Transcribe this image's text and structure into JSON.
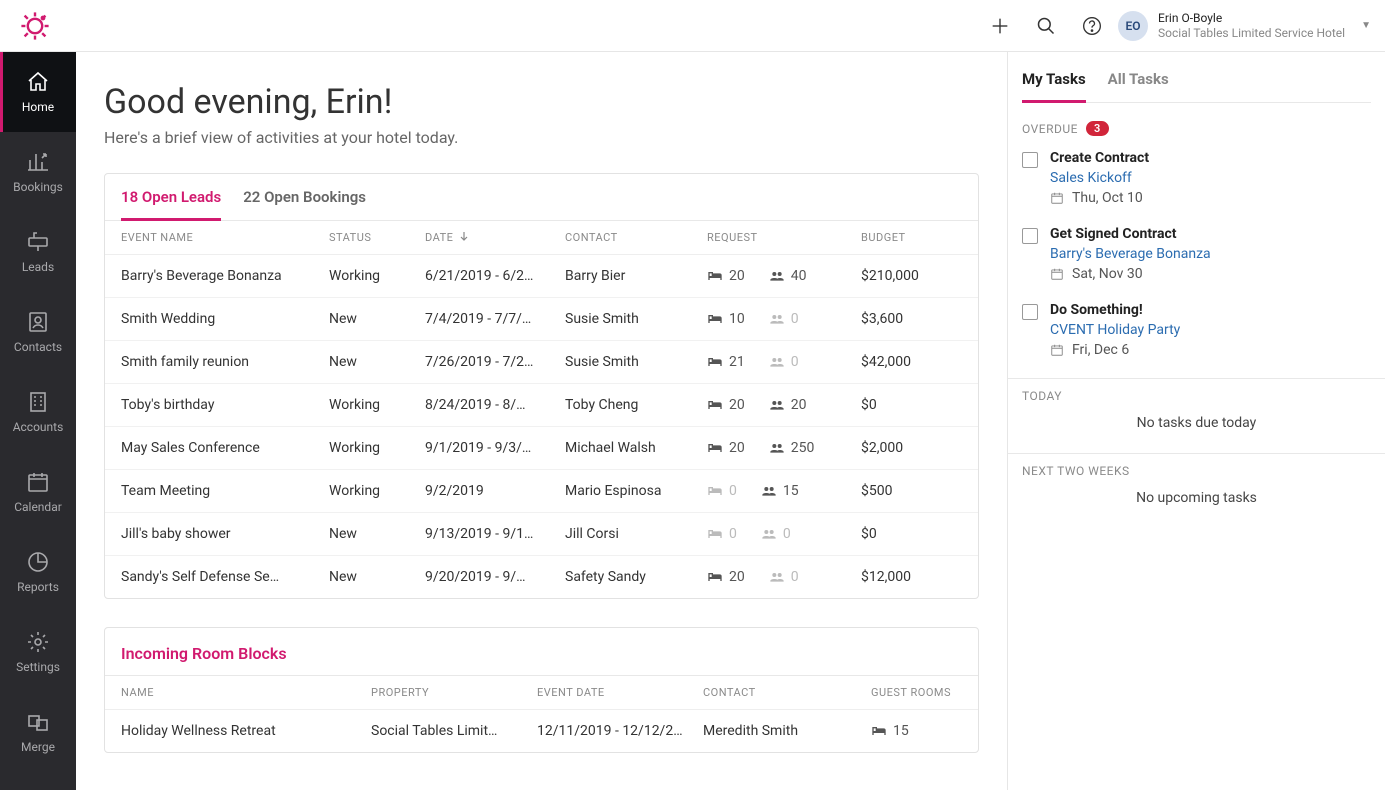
{
  "brand_color": "#d11a6f",
  "header": {
    "user_initials": "EO",
    "user_name": "Erin O-Boyle",
    "user_sub": "Social Tables Limited Service Hotel"
  },
  "sidebar": {
    "items": [
      {
        "label": "Home"
      },
      {
        "label": "Bookings"
      },
      {
        "label": "Leads"
      },
      {
        "label": "Contacts"
      },
      {
        "label": "Accounts"
      },
      {
        "label": "Calendar"
      },
      {
        "label": "Reports"
      },
      {
        "label": "Settings"
      },
      {
        "label": "Merge"
      }
    ]
  },
  "greeting": "Good evening, Erin!",
  "subgreeting": "Here's a brief view of activities at your hotel today.",
  "leads": {
    "tab_leads": "18 Open Leads",
    "tab_bookings": "22 Open Bookings",
    "headers": {
      "event": "EVENT NAME",
      "status": "STATUS",
      "date": "DATE",
      "contact": "CONTACT",
      "request": "REQUEST",
      "budget": "BUDGET"
    },
    "rows": [
      {
        "event": "Barry's Beverage Bonanza",
        "status": "Working",
        "date": "6/21/2019 - 6/2…",
        "contact": "Barry Bier",
        "rooms": "20",
        "people": "40",
        "budget": "$210,000"
      },
      {
        "event": "Smith Wedding",
        "status": "New",
        "date": "7/4/2019 - 7/7/…",
        "contact": "Susie Smith",
        "rooms": "10",
        "people": "0",
        "budget": "$3,600"
      },
      {
        "event": "Smith family reunion",
        "status": "New",
        "date": "7/26/2019 - 7/2…",
        "contact": "Susie Smith",
        "rooms": "21",
        "people": "0",
        "budget": "$42,000"
      },
      {
        "event": "Toby's birthday",
        "status": "Working",
        "date": "8/24/2019 - 8/…",
        "contact": "Toby Cheng",
        "rooms": "20",
        "people": "20",
        "budget": "$0"
      },
      {
        "event": "May Sales Conference",
        "status": "Working",
        "date": "9/1/2019 - 9/3/…",
        "contact": "Michael Walsh",
        "rooms": "20",
        "people": "250",
        "budget": "$2,000"
      },
      {
        "event": "Team Meeting",
        "status": "Working",
        "date": "9/2/2019",
        "contact": "Mario Espinosa",
        "rooms": "0",
        "people": "15",
        "budget": "$500"
      },
      {
        "event": "Jill's baby shower",
        "status": "New",
        "date": "9/13/2019 - 9/1…",
        "contact": "Jill Corsi",
        "rooms": "0",
        "people": "0",
        "budget": "$0"
      },
      {
        "event": "Sandy's Self Defense Se…",
        "status": "New",
        "date": "9/20/2019 - 9/…",
        "contact": "Safety Sandy",
        "rooms": "20",
        "people": "0",
        "budget": "$12,000"
      }
    ]
  },
  "roomblocks": {
    "title": "Incoming Room Blocks",
    "headers": {
      "name": "NAME",
      "property": "PROPERTY",
      "date": "EVENT DATE",
      "contact": "CONTACT",
      "rooms": "GUEST ROOMS"
    },
    "rows": [
      {
        "name": "Holiday Wellness Retreat",
        "property": "Social Tables Limit…",
        "date": "12/11/2019 - 12/12/2…",
        "contact": "Meredith Smith",
        "rooms": "15"
      }
    ]
  },
  "tasks": {
    "tab_my": "My Tasks",
    "tab_all": "All Tasks",
    "overdue_label": "OVERDUE",
    "overdue_count": "3",
    "overdue": [
      {
        "title": "Create Contract",
        "link": "Sales Kickoff",
        "date": "Thu, Oct 10"
      },
      {
        "title": "Get Signed Contract",
        "link": "Barry's Beverage Bonanza",
        "date": "Sat, Nov 30"
      },
      {
        "title": "Do Something!",
        "link": "CVENT Holiday Party",
        "date": "Fri, Dec 6"
      }
    ],
    "today_label": "TODAY",
    "today_empty": "No tasks due today",
    "next_label": "NEXT TWO WEEKS",
    "next_empty": "No upcoming tasks"
  }
}
